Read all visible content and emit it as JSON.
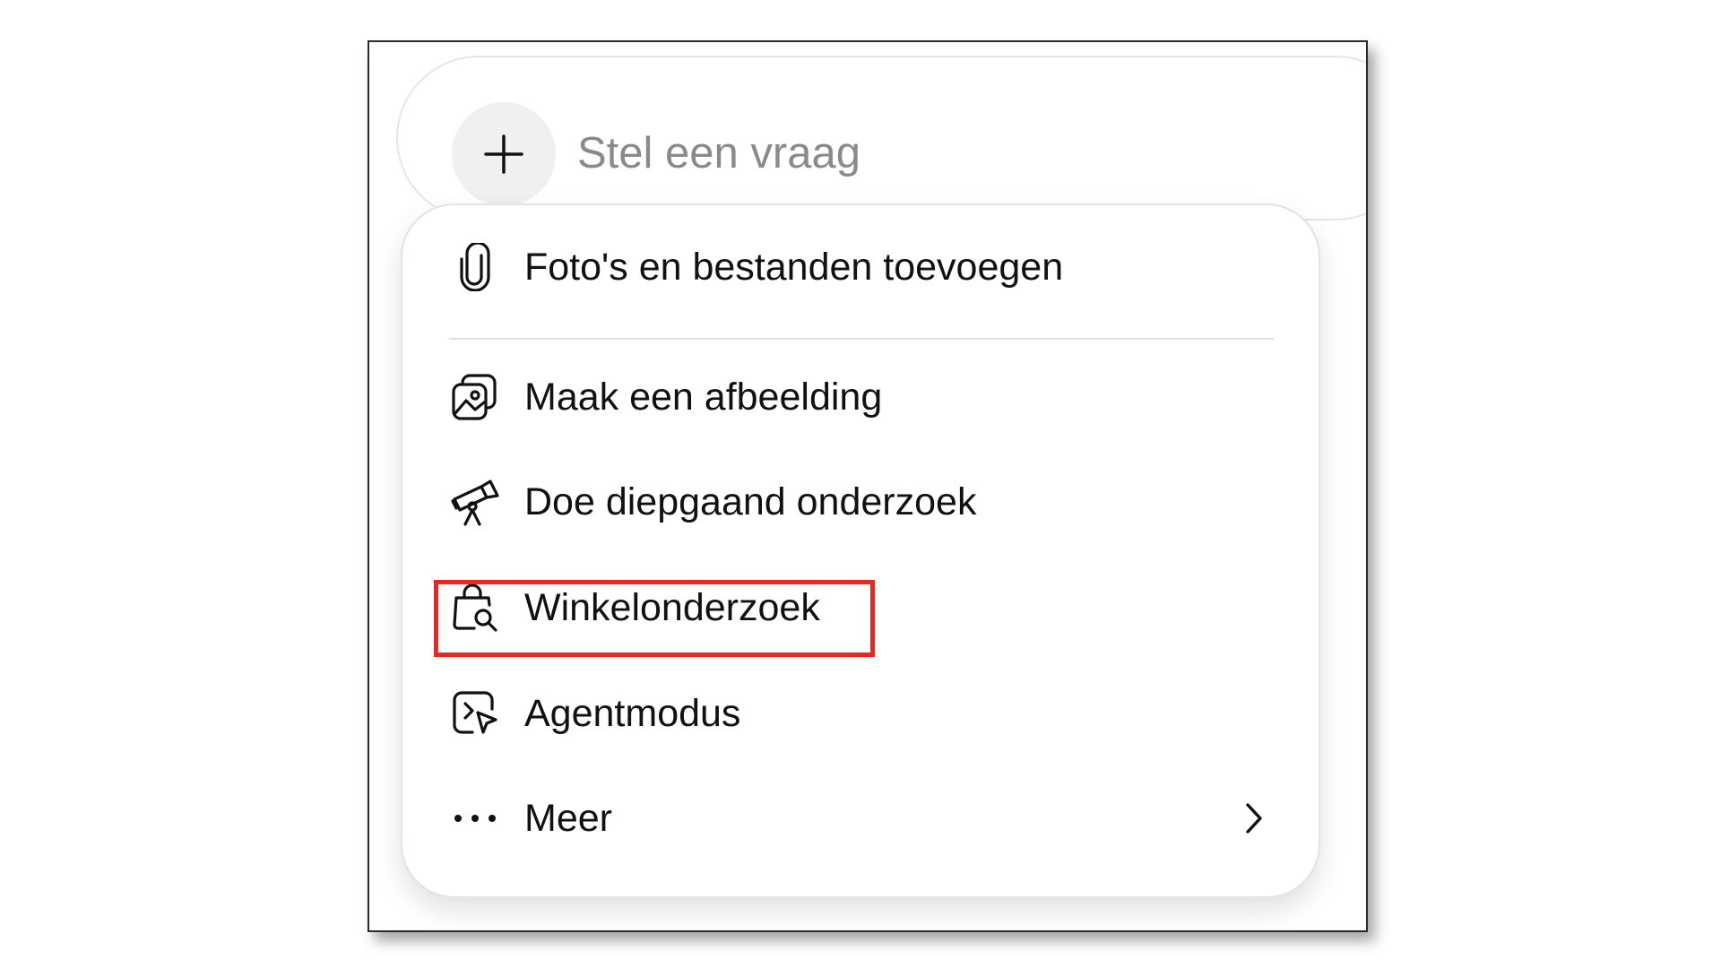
{
  "composer": {
    "placeholder": "Stel een vraag",
    "plus_icon": "plus-icon"
  },
  "menu": {
    "items": [
      {
        "label": "Foto's en bestanden toevoegen",
        "icon": "paperclip-icon"
      },
      {
        "label": "Maak een afbeelding",
        "icon": "image-icon"
      },
      {
        "label": "Doe diepgaand onderzoek",
        "icon": "telescope-icon"
      },
      {
        "label": "Winkelonderzoek",
        "icon": "shopping-bag-search-icon",
        "highlighted": true
      },
      {
        "label": "Agentmodus",
        "icon": "agent-cursor-icon"
      },
      {
        "label": "Meer",
        "icon": "more-dots-icon",
        "submenu_icon": "chevron-right-icon"
      }
    ]
  },
  "colors": {
    "highlight": "#e02a22",
    "text": "#111111",
    "placeholder": "#8a8a8a"
  }
}
